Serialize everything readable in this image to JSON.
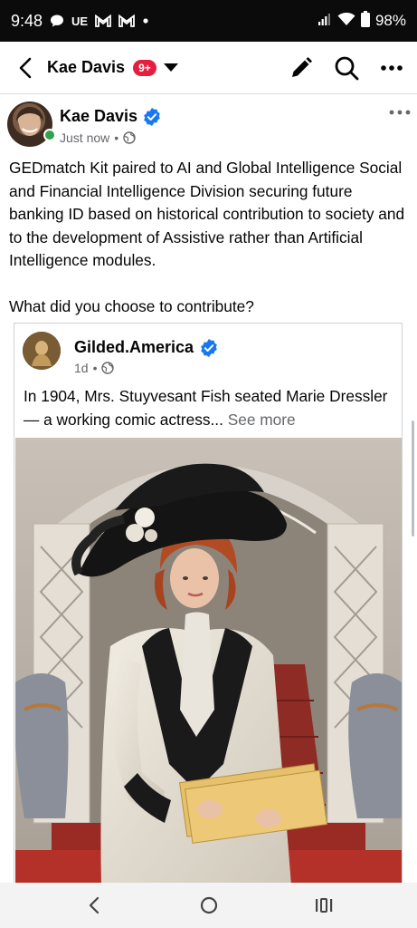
{
  "status_bar": {
    "time": "9:48",
    "battery": "98%",
    "carrier_label": "UE",
    "icons": [
      "chat-bubble-icon",
      "gmail-icon",
      "gmail-icon",
      "dot-icon",
      "signal-icon",
      "wifi-icon",
      "battery-icon"
    ]
  },
  "header": {
    "title": "Kae Davis",
    "badge": "9+",
    "actions": [
      "edit-icon",
      "search-icon",
      "more-icon"
    ]
  },
  "post": {
    "author": "Kae Davis",
    "time": "Just now",
    "privacy_icon": "globe-icon",
    "text_1": "GEDmatch Kit paired to AI and Global Intelligence Social and Financial Intelligence Division securing future banking ID based on historical contribution to society and to the development of Assistive rather than Artificial Intelligence modules.",
    "text_2": "What did you choose to contribute?"
  },
  "shared": {
    "author": "Gilded.America",
    "time": "1d",
    "text": "In 1904, Mrs. Stuyvesant Fish seated Marie Dressler — a working comic actress",
    "ellipsis": "...",
    "see_more": "See more"
  },
  "colors": {
    "verified": "#1877f2",
    "badge": "#e41e3f",
    "online": "#31a24c",
    "meta_gray": "#65676b"
  }
}
